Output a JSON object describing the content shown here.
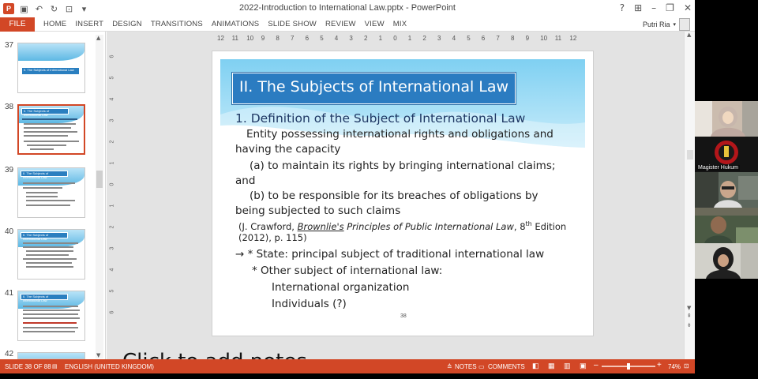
{
  "window": {
    "title": "2022-Introduction to International Law.pptx - PowerPoint",
    "controls": [
      "?",
      "⊞",
      "–",
      "❐",
      "✕"
    ]
  },
  "quick_access": [
    "save-icon",
    "undo-icon",
    "redo-icon",
    "presenter-icon",
    "customize-icon"
  ],
  "ribbon": {
    "file": "FILE",
    "tabs": [
      "HOME",
      "INSERT",
      "DESIGN",
      "TRANSITIONS",
      "ANIMATIONS",
      "SLIDE SHOW",
      "REVIEW",
      "VIEW",
      "MIX"
    ],
    "user": "Putri Ria"
  },
  "ruler": {
    "ticks": [
      "12",
      "11",
      "10",
      "9",
      "8",
      "7",
      "6",
      "5",
      "4",
      "3",
      "2",
      "1",
      "0",
      "1",
      "2",
      "3",
      "4",
      "5",
      "6",
      "7",
      "8",
      "9",
      "10",
      "11",
      "12"
    ],
    "vticks": [
      "6",
      "5",
      "4",
      "3",
      "2",
      "1",
      "0",
      "1",
      "2",
      "3",
      "4",
      "5",
      "6"
    ]
  },
  "thumbnails": [
    {
      "num": "37",
      "title": "II. The Subjects of International Law",
      "selected": false
    },
    {
      "num": "38",
      "title": "II. The Subjects of International Law",
      "selected": true
    },
    {
      "num": "39",
      "title": "II. The Subjects of International Law",
      "selected": false
    },
    {
      "num": "40",
      "title": "II. The Subjects of International Law",
      "selected": false
    },
    {
      "num": "41",
      "title": "II. The Subjects of International Law",
      "selected": false
    },
    {
      "num": "42",
      "title": "",
      "selected": false
    }
  ],
  "slide": {
    "title": "II. The Subjects of International Law",
    "subheading": "1. Definition of the Subject of International Law",
    "lines": [
      "Entity possessing international rights and obligations and",
      "having the capacity",
      "(a) to maintain its rights by bringing international claims;",
      "and",
      "(b) to be responsible for its breaches of obligations by",
      "being subjected to such claims"
    ],
    "citation": {
      "pre": "(J. Crawford, ",
      "book_underlined": "Brownlie's",
      "book_rest": " Principles of Public International Law",
      "edition_num": ", 8",
      "edition_sup": "th",
      "edition_rest": " Edition",
      "line2": "(2012), p. 115)"
    },
    "bullets": [
      "→ * State: principal subject of traditional international law",
      "* Other subject of international law:",
      "International organization",
      "Individuals (?)"
    ],
    "slide_number": "38",
    "accent_color": "#2b7cc1"
  },
  "next_slide_text": "Click to add notes",
  "status": {
    "slide_info": "SLIDE 38 OF 88",
    "language": "ENGLISH (UNITED KINGDOM)",
    "notes": "NOTES",
    "comments": "COMMENTS",
    "zoom": "74%",
    "zoom_level": 0.74,
    "bar_color": "#d24726"
  },
  "participants": [
    {
      "name": "",
      "bg": "#c9b8a8"
    },
    {
      "name": "Magister Hukum",
      "bg": "#1a1a1a"
    },
    {
      "name": "",
      "bg": "#5f6a60"
    },
    {
      "name": "",
      "bg": "#4d5c45"
    },
    {
      "name": "",
      "bg": "#cfcfc8"
    }
  ]
}
